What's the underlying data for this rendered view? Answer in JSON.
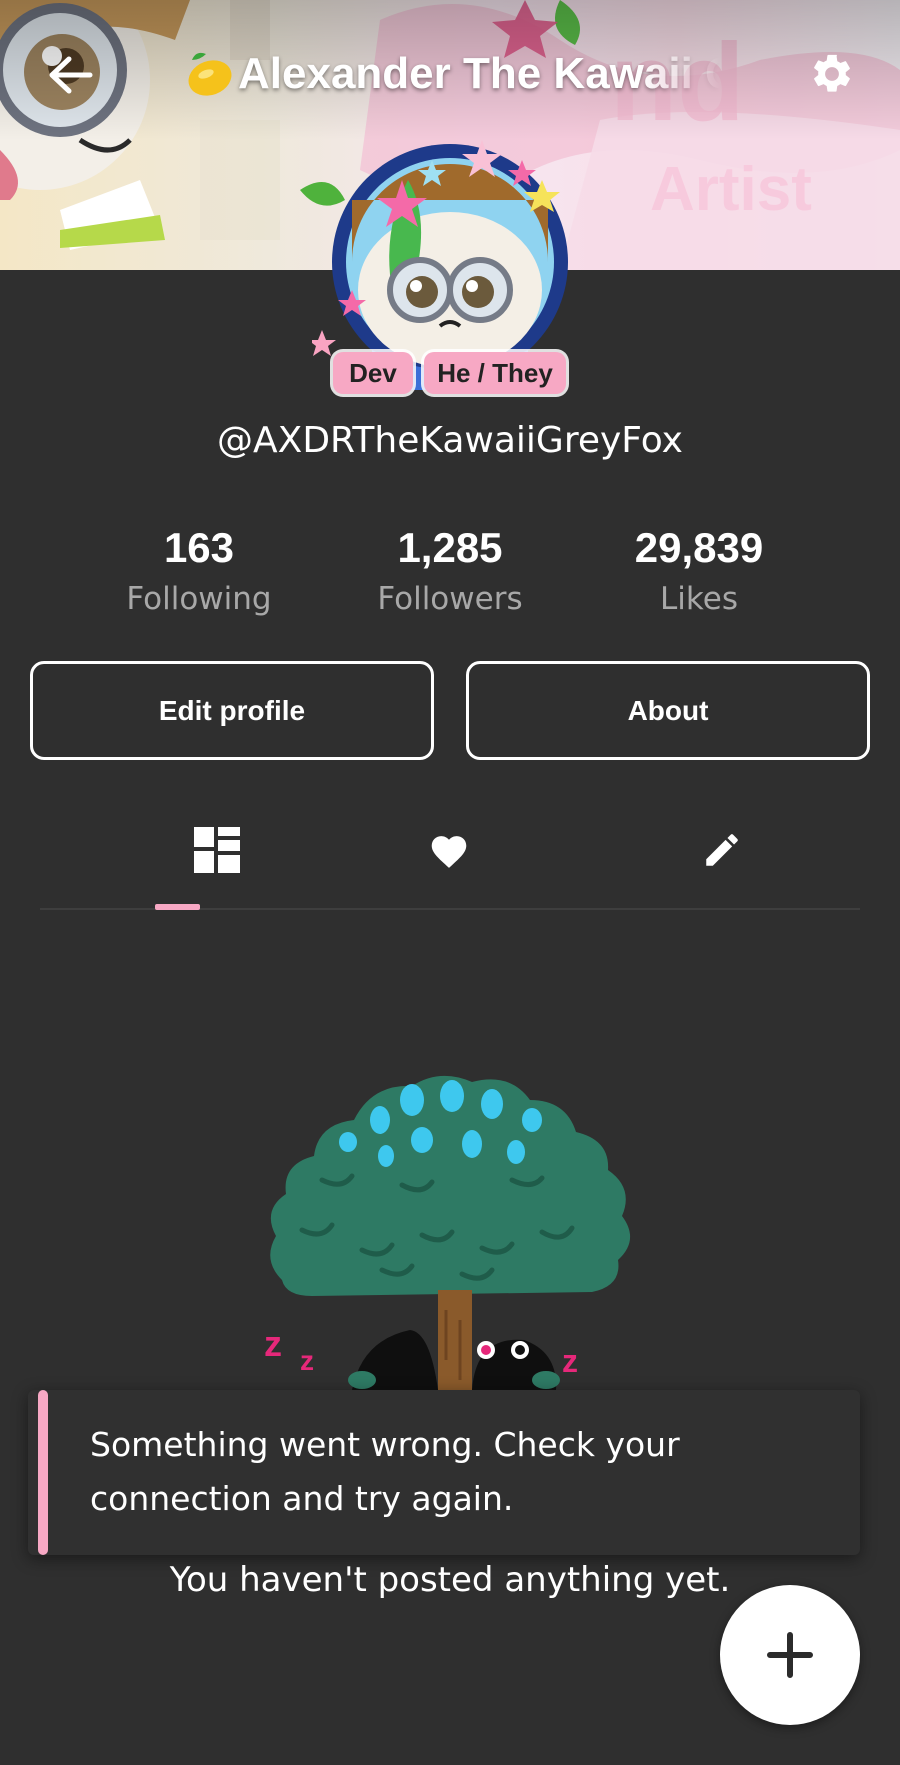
{
  "header": {
    "title": "Alexander The Kawaii Grey Fox",
    "title_emoji": "lemon-icon"
  },
  "profile": {
    "handle": "@AXDRTheKawaiiGreyFox",
    "badges": [
      "Dev",
      "He / They"
    ]
  },
  "stats": {
    "following": {
      "value": "163",
      "label": "Following"
    },
    "followers": {
      "value": "1,285",
      "label": "Followers"
    },
    "likes": {
      "value": "29,839",
      "label": "Likes"
    }
  },
  "actions": {
    "edit_profile": "Edit profile",
    "about": "About"
  },
  "tabs": [
    {
      "icon": "posts-grid-icon",
      "active": true
    },
    {
      "icon": "heart-icon",
      "active": false
    },
    {
      "icon": "pencil-icon",
      "active": false
    }
  ],
  "toast": {
    "message": "Something went wrong. Check your connection and try again."
  },
  "empty_state": {
    "message": "You haven't posted anything yet."
  },
  "fab": {
    "icon": "plus-icon"
  },
  "colors": {
    "background": "#2f2f2f",
    "accent_pink": "#f7a8c4",
    "muted_text": "#a8a8a8",
    "tree_green": "#2e7a64",
    "tree_spots": "#3ec8ee"
  }
}
